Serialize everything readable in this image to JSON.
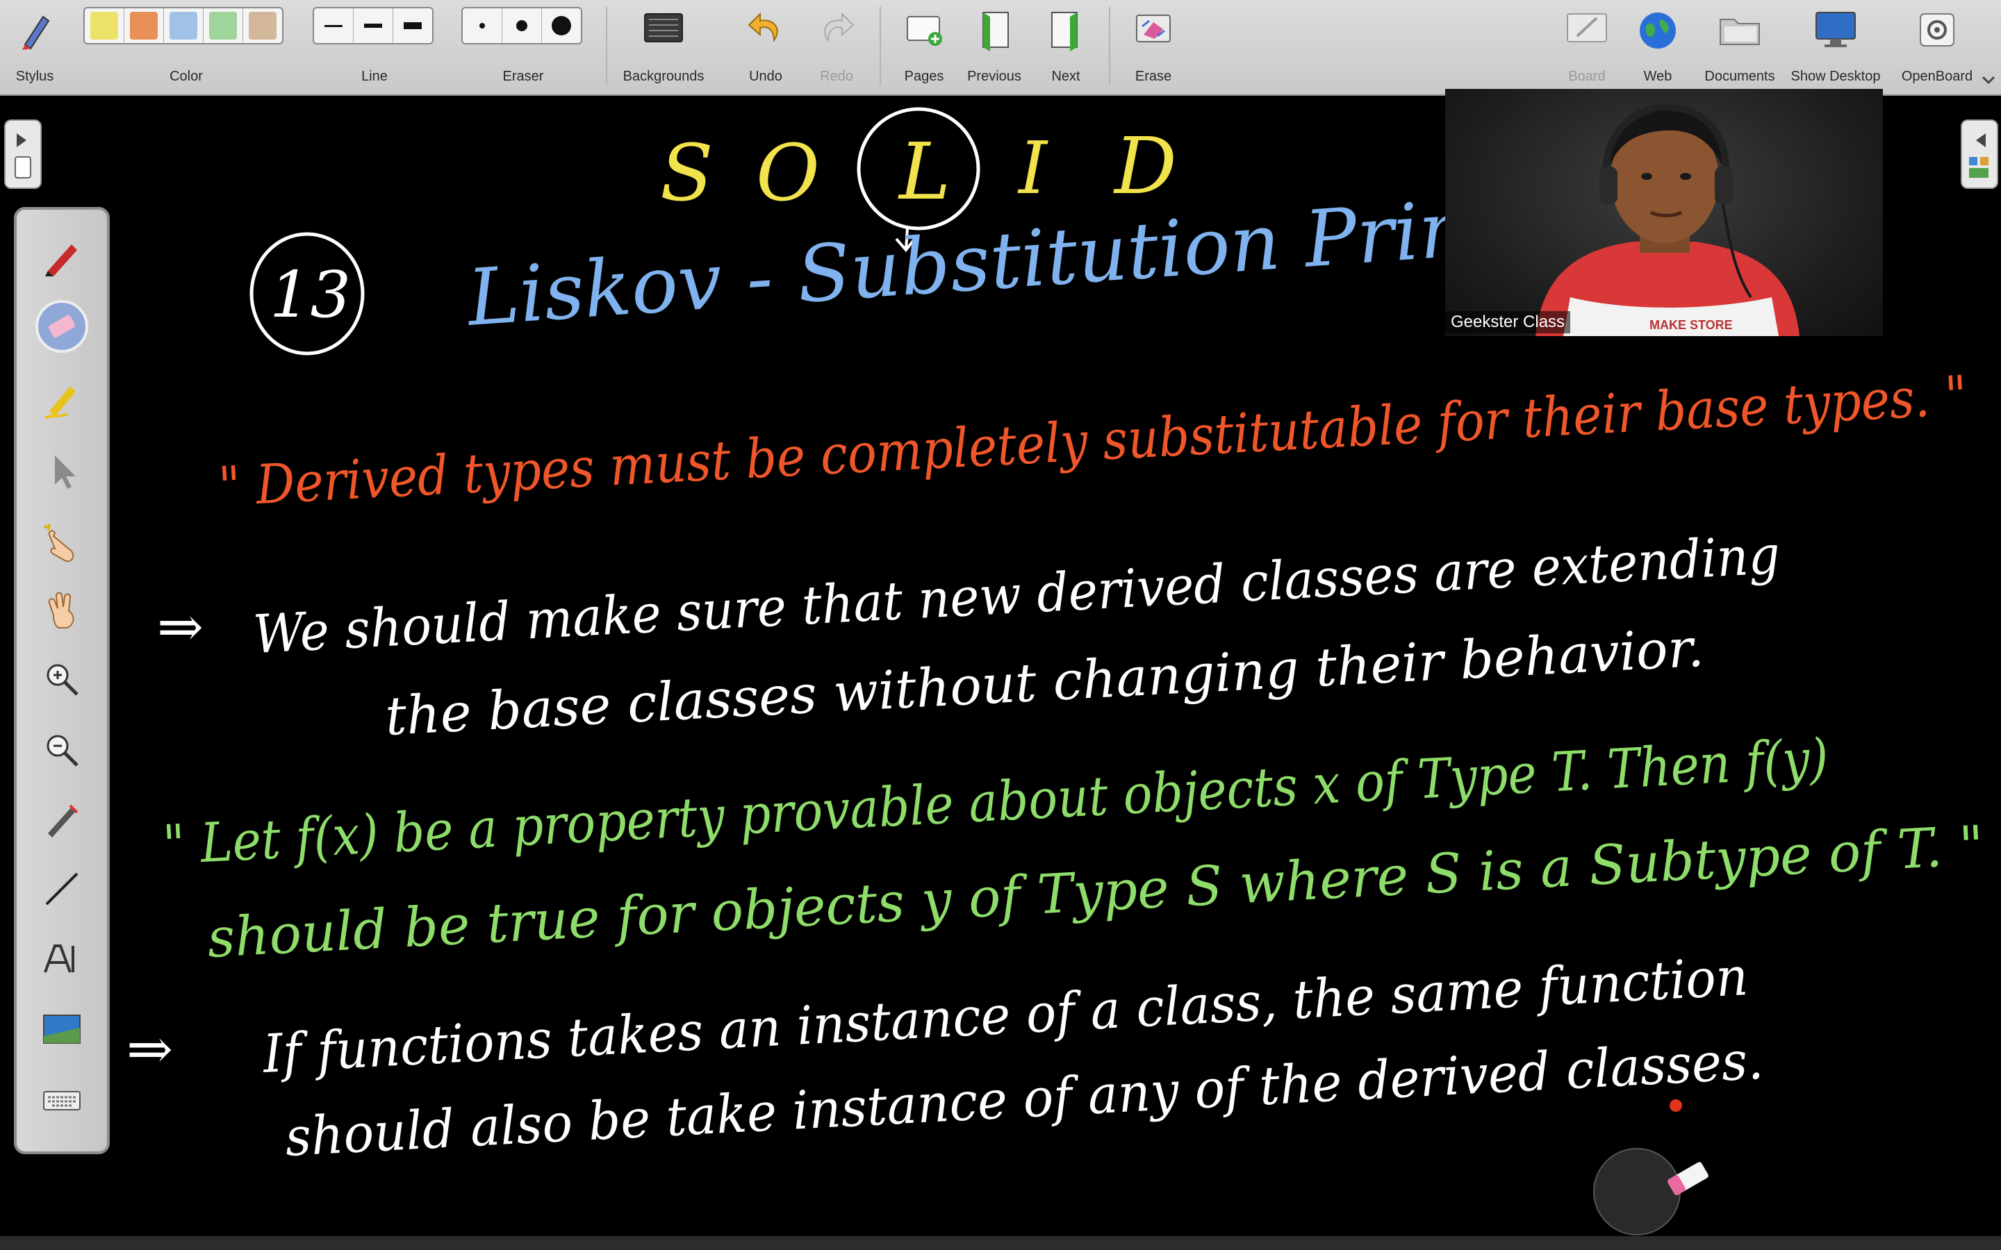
{
  "toolbar": {
    "stylus": "Stylus",
    "color": "Color",
    "line": "Line",
    "eraser": "Eraser",
    "backgrounds": "Backgrounds",
    "undo": "Undo",
    "redo": "Redo",
    "pages": "Pages",
    "previous": "Previous",
    "next": "Next",
    "erase": "Erase",
    "board": "Board",
    "web": "Web",
    "documents": "Documents",
    "show_desktop": "Show Desktop",
    "openboard": "OpenBoard",
    "swatches": [
      "#ece26a",
      "#e98f58",
      "#9fc2e6",
      "#9fd49a",
      "#d2b79a"
    ]
  },
  "board": {
    "heading_letters": [
      "S",
      "O",
      "L",
      "I",
      "D"
    ],
    "circled_number": "13",
    "title": "Liskov - Substitution Principle",
    "quote1": "\" Derived types must be completely substitutable for their base types. \"",
    "arrow": "⇒",
    "point1_line1": "We should make sure that new derived classes are extending",
    "point1_line2": "the base classes without changing their behavior.",
    "quote2_line1": "\" Let f(x) be a property provable about objects x of Type T. Then f(y)",
    "quote2_line2": "should be true for objects y of Type S where S is a Subtype of T. \"",
    "point2_line1": "If functions takes an instance of a class, the same function",
    "point2_line2": "should also be take instance of any of the derived classes.",
    "colors": {
      "yellow": "#f2e24b",
      "white": "#ffffff",
      "blue": "#7fb2ee",
      "orange": "#f0562a",
      "green": "#8edc6a"
    }
  },
  "webcam": {
    "name": "Geekster Class",
    "shirt_text": "MAKE STORE"
  }
}
